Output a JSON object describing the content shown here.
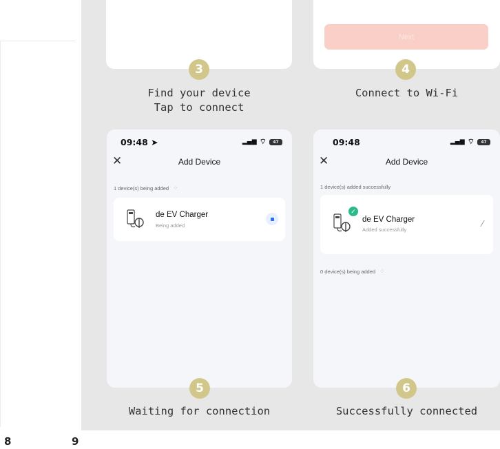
{
  "page_numbers": {
    "left": "8",
    "right": "9"
  },
  "step3": {
    "badge": "3",
    "caption_line1": "Find your device",
    "caption_line2": "Tap to connect"
  },
  "step4": {
    "badge": "4",
    "caption": "Connect to Wi-Fi",
    "next_button": "Next"
  },
  "step5": {
    "badge": "5",
    "caption": "Waiting for connection",
    "status_time": "09:48",
    "battery": "47",
    "nav_title": "Add Device",
    "subtitle": "1 device(s) being added",
    "device_name": "de EV Charger",
    "device_state": "Being added"
  },
  "step6": {
    "badge": "6",
    "caption": "Successfully connected",
    "status_time": "09:48",
    "battery": "47",
    "nav_title": "Add Device",
    "subtitle_top": "1 device(s) added successfully",
    "device_name": "de EV Charger",
    "device_state": "Added successfully",
    "subtitle_bottom": "0 device(s) being added"
  },
  "colors": {
    "panel_bg": "#e7e7e7",
    "badge": "#d2c78a",
    "next_button": "#f9cfc8",
    "success_green": "#2db98a",
    "progress_blue": "#2d6df6"
  },
  "icons": [
    "location-arrow-icon",
    "signal-icon",
    "wifi-icon",
    "battery-icon",
    "close-icon",
    "charger-device-icon",
    "progress-icon",
    "check-icon",
    "edit-icon",
    "spinner-icon"
  ]
}
